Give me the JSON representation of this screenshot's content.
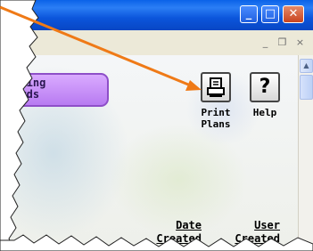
{
  "window": {
    "minimize_symbol": "_",
    "maximize_symbol": "□",
    "close_symbol": "✕"
  },
  "mdi": {
    "minimize_symbol": "_",
    "restore_symbol": "❐",
    "close_symbol": "×"
  },
  "scrollbar": {
    "up_symbol": "▲"
  },
  "buttons": {
    "teaching_standards": "aching\ndards"
  },
  "toolbar": {
    "print": {
      "icon": "printer-icon",
      "label": "Print\nPlans"
    },
    "help": {
      "icon": "question-icon",
      "glyph": "?",
      "label": "Help"
    }
  },
  "columns": {
    "date_created": "Date\nCreated",
    "user_created": "User\nCreated"
  },
  "colors": {
    "titlebar": "#0b55db",
    "close_button": "#c9431e",
    "standards_button": "#c58cf6",
    "arrow": "#ef7a17"
  },
  "annotation": {
    "type": "arrow",
    "target": "print-plans-button"
  }
}
